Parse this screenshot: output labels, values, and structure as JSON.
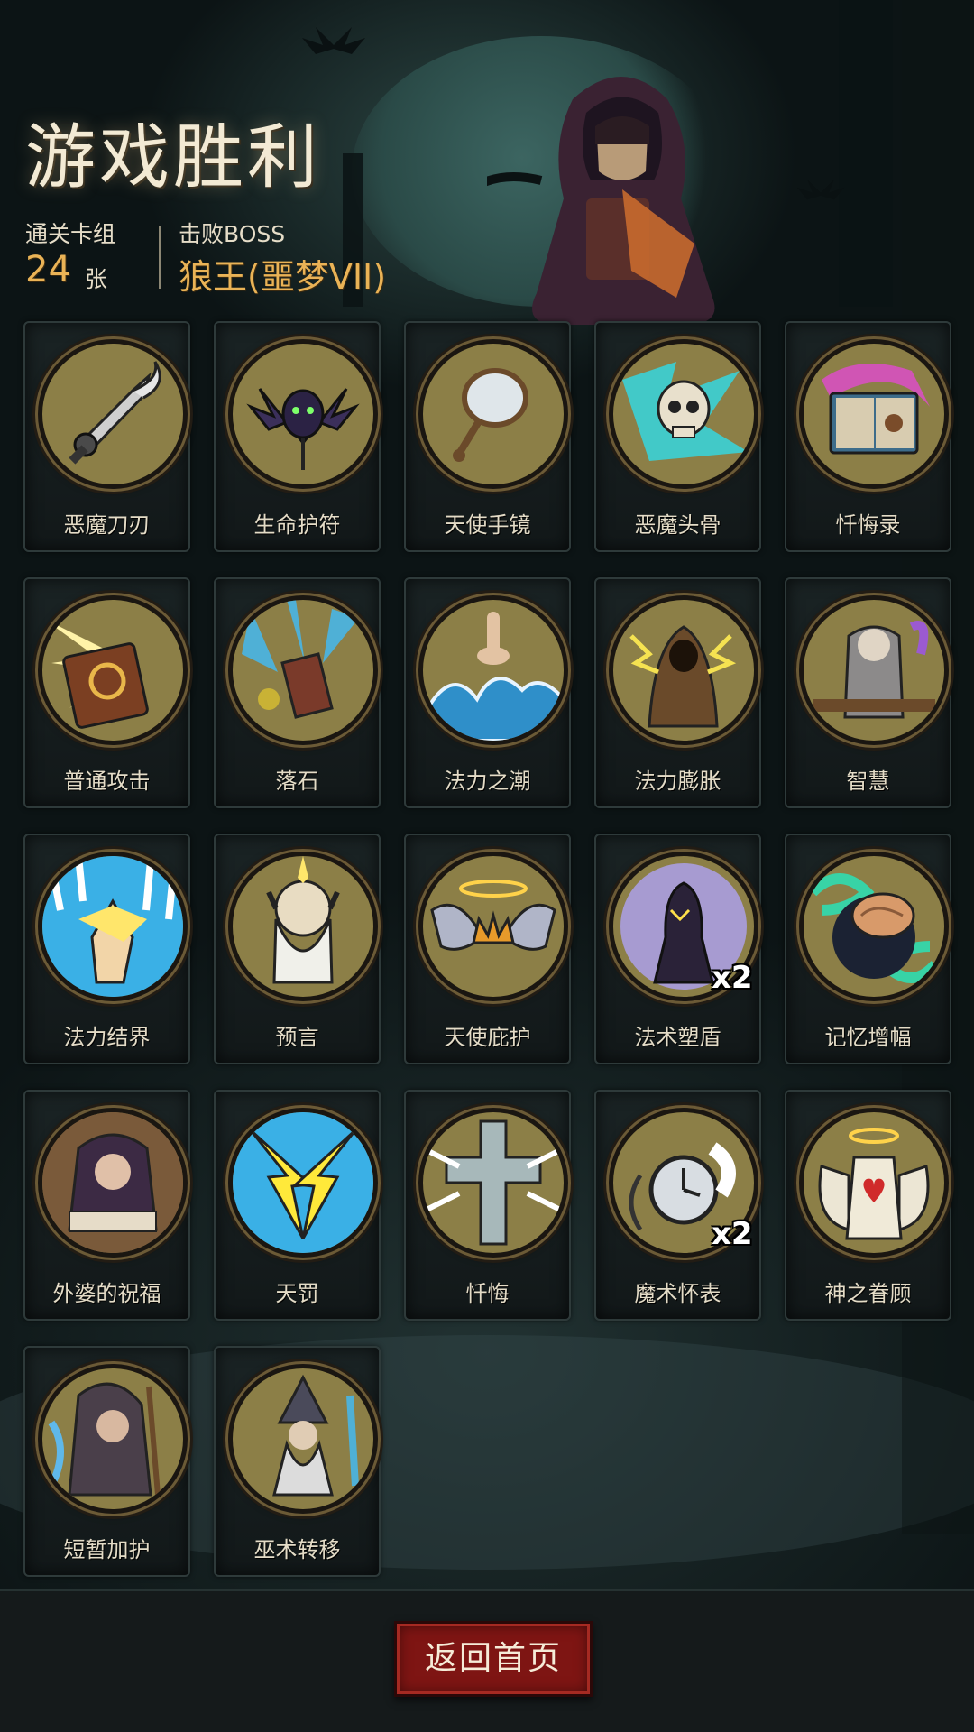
{
  "header": {
    "title": "游戏胜利",
    "deck_label": "通关卡组",
    "deck_count": "24",
    "deck_unit": "张",
    "boss_label": "击败BOSS",
    "boss_name": "狼王(噩梦VII)"
  },
  "cards": [
    {
      "name": "恶魔刀刃",
      "icon": "dagger-icon",
      "count": ""
    },
    {
      "name": "生命护符",
      "icon": "bat-amulet-icon",
      "count": ""
    },
    {
      "name": "天使手镜",
      "icon": "hand-mirror-icon",
      "count": ""
    },
    {
      "name": "恶魔头骨",
      "icon": "demon-skull-icon",
      "count": ""
    },
    {
      "name": "忏悔录",
      "icon": "spell-book-icon",
      "count": ""
    },
    {
      "name": "普通攻击",
      "icon": "glowing-book-icon",
      "count": ""
    },
    {
      "name": "落石",
      "icon": "falling-rock-icon",
      "count": ""
    },
    {
      "name": "法力之潮",
      "icon": "mana-wave-icon",
      "count": ""
    },
    {
      "name": "法力膨胀",
      "icon": "hooded-mage-icon",
      "count": ""
    },
    {
      "name": "智慧",
      "icon": "old-scholar-icon",
      "count": ""
    },
    {
      "name": "法力结界",
      "icon": "mana-barrier-icon",
      "count": ""
    },
    {
      "name": "预言",
      "icon": "prophet-icon",
      "count": ""
    },
    {
      "name": "天使庇护",
      "icon": "angel-crown-icon",
      "count": ""
    },
    {
      "name": "法术塑盾",
      "icon": "spell-shield-icon",
      "count": "x2"
    },
    {
      "name": "记忆增幅",
      "icon": "brain-icon",
      "count": ""
    },
    {
      "name": "外婆的祝福",
      "icon": "grandma-icon",
      "count": ""
    },
    {
      "name": "天罚",
      "icon": "lightning-icon",
      "count": ""
    },
    {
      "name": "忏悔",
      "icon": "cross-icon",
      "count": ""
    },
    {
      "name": "魔术怀表",
      "icon": "pocket-watch-icon",
      "count": "x2"
    },
    {
      "name": "神之眷顾",
      "icon": "angel-heart-icon",
      "count": ""
    },
    {
      "name": "短暂加护",
      "icon": "hooded-elder-icon",
      "count": ""
    },
    {
      "name": "巫术转移",
      "icon": "wizard-icon",
      "count": ""
    }
  ],
  "footer": {
    "home_label": "返回首页",
    "button_color": "#7e1513"
  },
  "colors": {
    "accent": "#eab356",
    "card_art_bg": "#8c7f47"
  }
}
